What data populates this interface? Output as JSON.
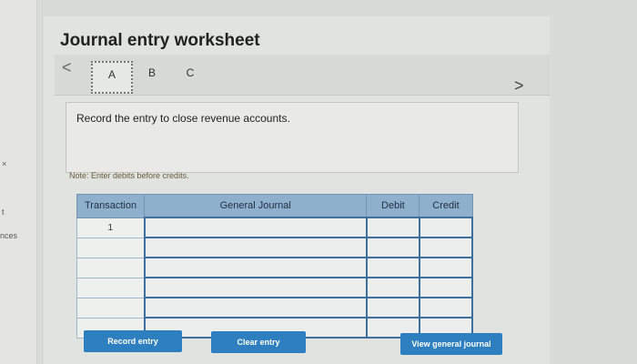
{
  "left_strip": {
    "text_1": "t",
    "text_2": "nces",
    "close": "×"
  },
  "worksheet": {
    "title": "Journal entry worksheet"
  },
  "tabs": [
    {
      "label": "A"
    },
    {
      "label": "B"
    },
    {
      "label": "C"
    }
  ],
  "nav": {
    "prev": "<",
    "next": ">"
  },
  "instruction": "Record the entry to close revenue accounts.",
  "note": "Note: Enter debits before credits.",
  "table": {
    "headers": {
      "transaction": "Transaction",
      "general_journal": "General Journal",
      "debit": "Debit",
      "credit": "Credit"
    },
    "first_row_number": "1"
  },
  "buttons": {
    "record": "Record entry",
    "clear": "Clear entry",
    "view": "View general journal"
  }
}
